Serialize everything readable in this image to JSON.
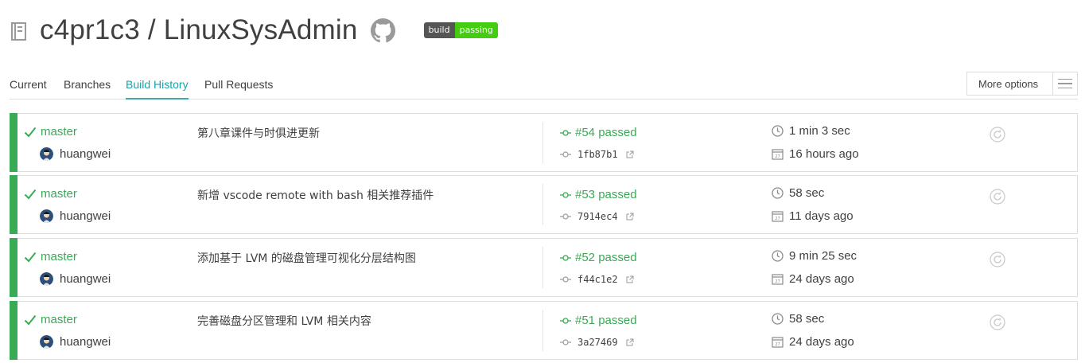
{
  "header": {
    "owner": "c4pr1c3",
    "separator": " / ",
    "repo": "LinuxSysAdmin",
    "badge": {
      "left": "build",
      "right": "passing",
      "right_color": "#4c1"
    }
  },
  "tabs": [
    {
      "label": "Current",
      "active": false
    },
    {
      "label": "Branches",
      "active": false
    },
    {
      "label": "Build History",
      "active": true
    },
    {
      "label": "Pull Requests",
      "active": false
    }
  ],
  "more_options": {
    "label": "More options",
    "icon": "hamburger-menu-icon"
  },
  "colors": {
    "passed": "#39aa56",
    "accent": "#19a3a6",
    "text": "#404040",
    "border": "#dedede"
  },
  "builds": [
    {
      "branch": "master",
      "author": "huangwei",
      "message": "第八章课件与时俱进更新",
      "build": "#54 passed",
      "commit": "1fb87b1",
      "duration": "1 min 3 sec",
      "finished": "16 hours ago",
      "status": "passed"
    },
    {
      "branch": "master",
      "author": "huangwei",
      "message": "新增 vscode remote with bash 相关推荐插件",
      "build": "#53 passed",
      "commit": "7914ec4",
      "duration": "58 sec",
      "finished": "11 days ago",
      "status": "passed"
    },
    {
      "branch": "master",
      "author": "huangwei",
      "message": "添加基于 LVM 的磁盘管理可视化分层结构图",
      "build": "#52 passed",
      "commit": "f44c1e2",
      "duration": "9 min 25 sec",
      "finished": "24 days ago",
      "status": "passed"
    },
    {
      "branch": "master",
      "author": "huangwei",
      "message": "完善磁盘分区管理和 LVM 相关内容",
      "build": "#51 passed",
      "commit": "3a27469",
      "duration": "58 sec",
      "finished": "24 days ago",
      "status": "passed"
    }
  ]
}
